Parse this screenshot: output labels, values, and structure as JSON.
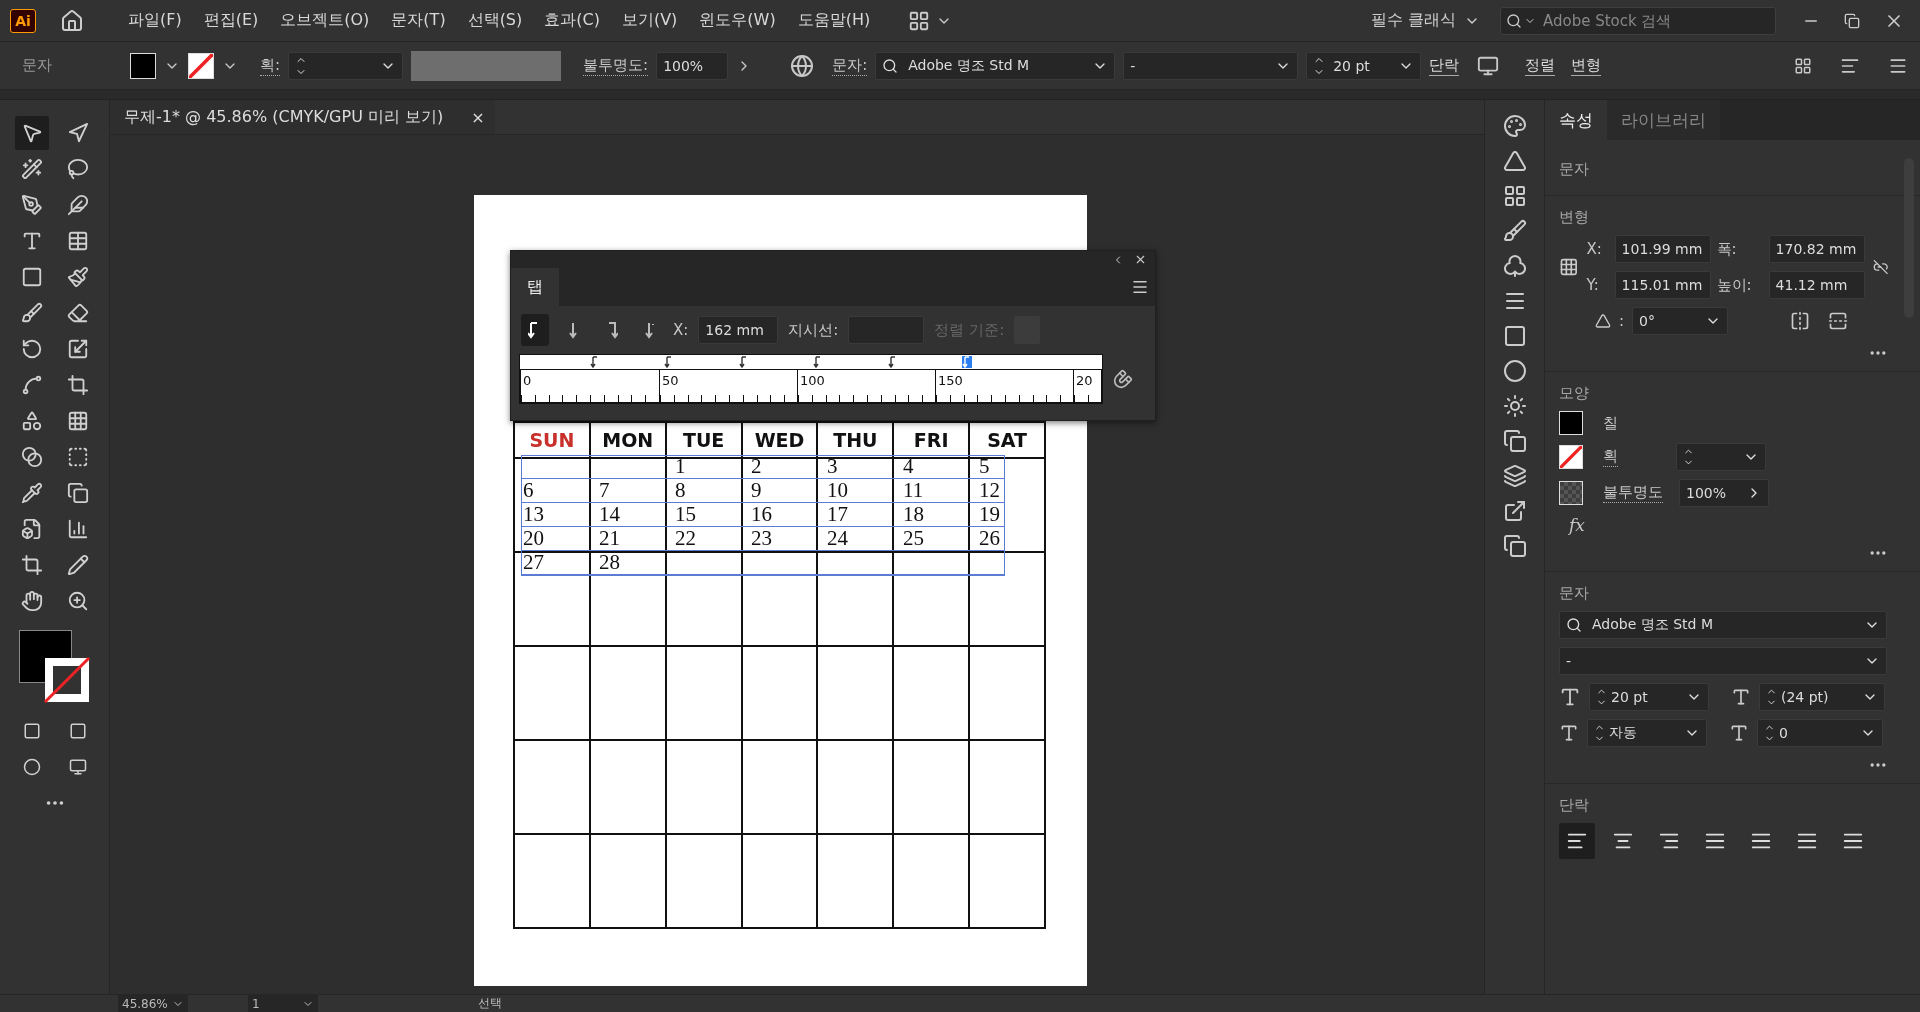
{
  "app": {
    "logo": "Ai"
  },
  "menu": [
    "파일(F)",
    "편집(E)",
    "오브젝트(O)",
    "문자(T)",
    "선택(S)",
    "효과(C)",
    "보기(V)",
    "윈도우(W)",
    "도움말(H)"
  ],
  "workspace": "필수 클래식",
  "stock_search": {
    "placeholder": "Adobe Stock 검색"
  },
  "control_bar": {
    "label": "문자",
    "stroke_label": "획:",
    "opacity_label": "불투명도:",
    "opacity": "100%",
    "char_label": "문자:",
    "font": "Adobe 명조 Std M",
    "style": "-",
    "size": "20 pt",
    "links": [
      "단락",
      "정렬",
      "변형"
    ]
  },
  "document_tab": {
    "title": "무제-1* @ 45.86% (CMYK/GPU 미리 보기)",
    "close": "×"
  },
  "tabs_panel": {
    "title": "탭",
    "x_label": "X:",
    "x": "162 mm",
    "leader_label": "지시선:",
    "align_label": "정렬 기준:",
    "align_buttons": [
      {
        "kind": "left",
        "selected": true
      },
      {
        "kind": "center",
        "selected": false
      },
      {
        "kind": "right",
        "selected": false
      },
      {
        "kind": "decimal",
        "selected": false
      }
    ],
    "tab_stops": [
      {
        "selected": false
      },
      {
        "selected": false
      },
      {
        "selected": false
      },
      {
        "selected": false
      },
      {
        "selected": false
      },
      {
        "selected": true
      }
    ],
    "ruler_labels": [
      "0",
      "50",
      "100",
      "150",
      "20"
    ]
  },
  "calendar": {
    "days": [
      {
        "label": "SUN",
        "color": "#c8312a"
      },
      {
        "label": "MON",
        "color": "#111111"
      },
      {
        "label": "TUE",
        "color": "#111111"
      },
      {
        "label": "WED",
        "color": "#111111"
      },
      {
        "label": "THU",
        "color": "#111111"
      },
      {
        "label": "FRI",
        "color": "#111111"
      },
      {
        "label": "SAT",
        "color": "#111111"
      }
    ],
    "weeks": [
      [
        {
          "kind": "blank"
        },
        {
          "kind": "blank"
        },
        {
          "kind": "date",
          "text": "1"
        },
        {
          "kind": "date",
          "text": "2"
        },
        {
          "kind": "date",
          "text": "3"
        },
        {
          "kind": "date",
          "text": "4"
        },
        {
          "kind": "date",
          "text": "5"
        }
      ],
      [
        {
          "kind": "date",
          "text": "6"
        },
        {
          "kind": "date",
          "text": "7"
        },
        {
          "kind": "date",
          "text": "8"
        },
        {
          "kind": "date",
          "text": "9"
        },
        {
          "kind": "date",
          "text": "10"
        },
        {
          "kind": "date",
          "text": "11"
        },
        {
          "kind": "date",
          "text": "12"
        }
      ],
      [
        {
          "kind": "date",
          "text": "13"
        },
        {
          "kind": "date",
          "text": "14"
        },
        {
          "kind": "date",
          "text": "15"
        },
        {
          "kind": "date",
          "text": "16"
        },
        {
          "kind": "date",
          "text": "17"
        },
        {
          "kind": "date",
          "text": "18"
        },
        {
          "kind": "date",
          "text": "19"
        }
      ],
      [
        {
          "kind": "date",
          "text": "20"
        },
        {
          "kind": "date",
          "text": "21"
        },
        {
          "kind": "date",
          "text": "22"
        },
        {
          "kind": "date",
          "text": "23"
        },
        {
          "kind": "date",
          "text": "24"
        },
        {
          "kind": "date",
          "text": "25"
        },
        {
          "kind": "date",
          "text": "26"
        }
      ],
      [
        {
          "kind": "date",
          "text": "27"
        },
        {
          "kind": "date",
          "text": "28"
        }
      ]
    ]
  },
  "properties": {
    "tabs": [
      {
        "label": "속성",
        "selected": true
      },
      {
        "label": "라이브러리",
        "selected": false
      }
    ],
    "heading": "문자",
    "transform": {
      "title": "변형",
      "x_label": "X:",
      "x": "101.99 mm",
      "y_label": "Y:",
      "y": "115.01 mm",
      "w_label": "폭:",
      "w": "170.82 mm",
      "h_label": "높이:",
      "h": "41.12 mm",
      "angle_label": ":",
      "angle": "0°"
    },
    "appearance": {
      "title": "모양",
      "fill": "칠",
      "stroke": "획",
      "opacity_label": "불투명도",
      "opacity": "100%",
      "fx": "fx"
    },
    "character": {
      "title": "문자",
      "font": "Adobe 명조 Std M",
      "style": "-",
      "size": "20 pt",
      "leading": "(24 pt)",
      "kerning": "자동",
      "tracking": "0"
    },
    "paragraph": {
      "title": "단락",
      "align": [
        {
          "selected": true
        },
        {
          "selected": false
        },
        {
          "selected": false
        },
        {
          "selected": false
        },
        {
          "selected": false
        },
        {
          "selected": false
        },
        {
          "selected": false
        }
      ]
    }
  },
  "status_bar": {
    "zoom": "45.86%",
    "page": "1",
    "mode": "선택"
  }
}
